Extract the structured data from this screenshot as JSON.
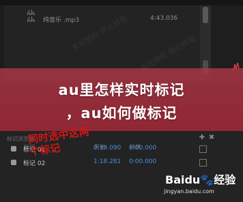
{
  "files": [
    {
      "name": "",
      "duration": ""
    },
    {
      "name": "纯音乐 .mp3",
      "duration": "4:43.036"
    }
  ],
  "banner": {
    "line1": "au里怎样实时标记",
    "line2": "，au如何做标记"
  },
  "marker_panel": {
    "title": "标记浏览器",
    "col_marker": "标记",
    "col_start": "开始",
    "col_duration": "持续",
    "rows": [
      {
        "label": "标记 01",
        "start": "0:39.090",
        "duration": "0:00.000"
      },
      {
        "label": "标记 02",
        "start": "1:18.281",
        "duration": "0:00.000"
      }
    ]
  },
  "annotation": {
    "line1": "同时选中这两",
    "line2": "个标记"
  },
  "brand": {
    "logo_text": "Baidu",
    "logo_suffix": "经验",
    "url": "jingyan.baidu.com"
  },
  "colors": {
    "banner": "#ad3746",
    "time_blue": "#4a8fe0",
    "annotation_red": "#d01818",
    "baidu_blue": "#2c6ee2"
  }
}
